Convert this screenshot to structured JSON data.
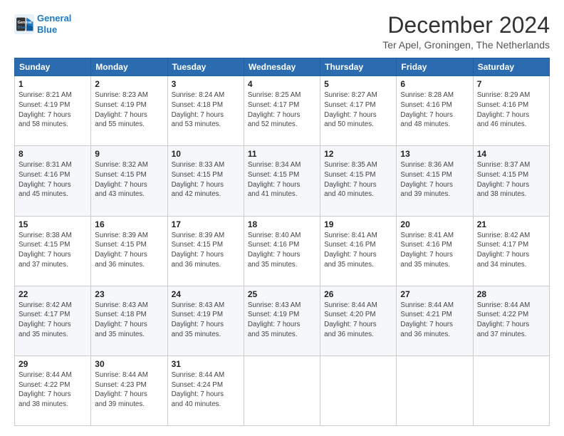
{
  "logo": {
    "line1": "General",
    "line2": "Blue"
  },
  "title": "December 2024",
  "subtitle": "Ter Apel, Groningen, The Netherlands",
  "headers": [
    "Sunday",
    "Monday",
    "Tuesday",
    "Wednesday",
    "Thursday",
    "Friday",
    "Saturday"
  ],
  "weeks": [
    [
      {
        "day": "1",
        "sunrise": "8:21 AM",
        "sunset": "4:19 PM",
        "daylight": "7 hours and 58 minutes."
      },
      {
        "day": "2",
        "sunrise": "8:23 AM",
        "sunset": "4:19 PM",
        "daylight": "7 hours and 55 minutes."
      },
      {
        "day": "3",
        "sunrise": "8:24 AM",
        "sunset": "4:18 PM",
        "daylight": "7 hours and 53 minutes."
      },
      {
        "day": "4",
        "sunrise": "8:25 AM",
        "sunset": "4:17 PM",
        "daylight": "7 hours and 52 minutes."
      },
      {
        "day": "5",
        "sunrise": "8:27 AM",
        "sunset": "4:17 PM",
        "daylight": "7 hours and 50 minutes."
      },
      {
        "day": "6",
        "sunrise": "8:28 AM",
        "sunset": "4:16 PM",
        "daylight": "7 hours and 48 minutes."
      },
      {
        "day": "7",
        "sunrise": "8:29 AM",
        "sunset": "4:16 PM",
        "daylight": "7 hours and 46 minutes."
      }
    ],
    [
      {
        "day": "8",
        "sunrise": "8:31 AM",
        "sunset": "4:16 PM",
        "daylight": "7 hours and 45 minutes."
      },
      {
        "day": "9",
        "sunrise": "8:32 AM",
        "sunset": "4:15 PM",
        "daylight": "7 hours and 43 minutes."
      },
      {
        "day": "10",
        "sunrise": "8:33 AM",
        "sunset": "4:15 PM",
        "daylight": "7 hours and 42 minutes."
      },
      {
        "day": "11",
        "sunrise": "8:34 AM",
        "sunset": "4:15 PM",
        "daylight": "7 hours and 41 minutes."
      },
      {
        "day": "12",
        "sunrise": "8:35 AM",
        "sunset": "4:15 PM",
        "daylight": "7 hours and 40 minutes."
      },
      {
        "day": "13",
        "sunrise": "8:36 AM",
        "sunset": "4:15 PM",
        "daylight": "7 hours and 39 minutes."
      },
      {
        "day": "14",
        "sunrise": "8:37 AM",
        "sunset": "4:15 PM",
        "daylight": "7 hours and 38 minutes."
      }
    ],
    [
      {
        "day": "15",
        "sunrise": "8:38 AM",
        "sunset": "4:15 PM",
        "daylight": "7 hours and 37 minutes."
      },
      {
        "day": "16",
        "sunrise": "8:39 AM",
        "sunset": "4:15 PM",
        "daylight": "7 hours and 36 minutes."
      },
      {
        "day": "17",
        "sunrise": "8:39 AM",
        "sunset": "4:15 PM",
        "daylight": "7 hours and 36 minutes."
      },
      {
        "day": "18",
        "sunrise": "8:40 AM",
        "sunset": "4:16 PM",
        "daylight": "7 hours and 35 minutes."
      },
      {
        "day": "19",
        "sunrise": "8:41 AM",
        "sunset": "4:16 PM",
        "daylight": "7 hours and 35 minutes."
      },
      {
        "day": "20",
        "sunrise": "8:41 AM",
        "sunset": "4:16 PM",
        "daylight": "7 hours and 35 minutes."
      },
      {
        "day": "21",
        "sunrise": "8:42 AM",
        "sunset": "4:17 PM",
        "daylight": "7 hours and 34 minutes."
      }
    ],
    [
      {
        "day": "22",
        "sunrise": "8:42 AM",
        "sunset": "4:17 PM",
        "daylight": "7 hours and 35 minutes."
      },
      {
        "day": "23",
        "sunrise": "8:43 AM",
        "sunset": "4:18 PM",
        "daylight": "7 hours and 35 minutes."
      },
      {
        "day": "24",
        "sunrise": "8:43 AM",
        "sunset": "4:19 PM",
        "daylight": "7 hours and 35 minutes."
      },
      {
        "day": "25",
        "sunrise": "8:43 AM",
        "sunset": "4:19 PM",
        "daylight": "7 hours and 35 minutes."
      },
      {
        "day": "26",
        "sunrise": "8:44 AM",
        "sunset": "4:20 PM",
        "daylight": "7 hours and 36 minutes."
      },
      {
        "day": "27",
        "sunrise": "8:44 AM",
        "sunset": "4:21 PM",
        "daylight": "7 hours and 36 minutes."
      },
      {
        "day": "28",
        "sunrise": "8:44 AM",
        "sunset": "4:22 PM",
        "daylight": "7 hours and 37 minutes."
      }
    ],
    [
      {
        "day": "29",
        "sunrise": "8:44 AM",
        "sunset": "4:22 PM",
        "daylight": "7 hours and 38 minutes."
      },
      {
        "day": "30",
        "sunrise": "8:44 AM",
        "sunset": "4:23 PM",
        "daylight": "7 hours and 39 minutes."
      },
      {
        "day": "31",
        "sunrise": "8:44 AM",
        "sunset": "4:24 PM",
        "daylight": "7 hours and 40 minutes."
      },
      null,
      null,
      null,
      null
    ]
  ]
}
